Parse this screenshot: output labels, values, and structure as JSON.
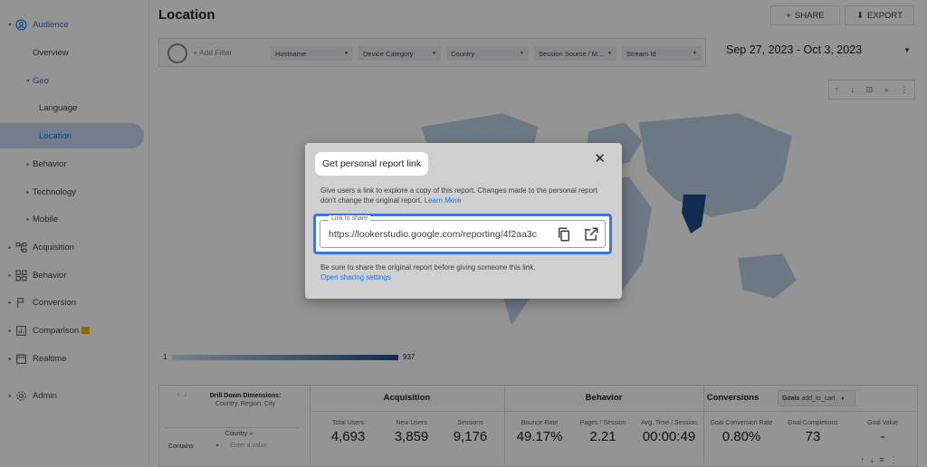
{
  "sidebar": {
    "items": [
      {
        "label": "Audience",
        "icon": "person-circle-icon",
        "caret": "▾"
      },
      {
        "label": "Overview"
      },
      {
        "label": "Geo",
        "caret": "▾"
      },
      {
        "label": "Language"
      },
      {
        "label": "Location"
      },
      {
        "label": "Behavior",
        "caret": "▸"
      },
      {
        "label": "Technology",
        "caret": "▸"
      },
      {
        "label": "Mobile",
        "caret": "▸"
      },
      {
        "label": "Acquisition",
        "icon": "hierarchy-icon",
        "caret": "▸"
      },
      {
        "label": "Behavior",
        "icon": "grid-icon",
        "caret": "▸"
      },
      {
        "label": "Conversion",
        "icon": "flag-icon",
        "caret": "▸"
      },
      {
        "label": "Comparison",
        "icon": "bar-chart-icon",
        "caret": "▸"
      },
      {
        "label": "Realtime",
        "icon": "calendar-icon",
        "caret": "▸"
      },
      {
        "label": "Admin",
        "icon": "gear-icon",
        "caret": "▸"
      }
    ]
  },
  "header": {
    "title": "Location",
    "share_label": "SHARE",
    "export_label": "EXPORT"
  },
  "filters": {
    "add_filter": "+ Add Filter",
    "dropdowns": [
      "Hostname",
      "Device Category",
      "Country",
      "Session Source / M...",
      "Stream Id"
    ]
  },
  "date_range": "Sep 27, 2023 - Oct 3, 2023",
  "map_scale": {
    "min": "1",
    "max": "937"
  },
  "table": {
    "drill_down": "Drill Down Dimensions:",
    "drill_down_fields": "Country, Region, City",
    "country_label": "Country",
    "contains_label": "Contains",
    "value_placeholder": "Enter a value",
    "groups": {
      "acquisition": "Acquisition",
      "behavior": "Behavior",
      "conversions": "Conversions"
    },
    "goals_label": "Goals",
    "goals_value": "add_to_cart",
    "metrics": [
      {
        "label": "Total Users",
        "value": "4,693"
      },
      {
        "label": "New Users",
        "value": "3,859"
      },
      {
        "label": "Sessions",
        "value": "9,176"
      },
      {
        "label": "Bounce Rate",
        "value": "49.17%"
      },
      {
        "label": "Pages / Session",
        "value": "2.21"
      },
      {
        "label": "Avg. Time / Session",
        "value": "00:00:49"
      },
      {
        "label": "Goal Conversion Rate",
        "value": "0.80%"
      },
      {
        "label": "Goal Completions",
        "value": "73"
      },
      {
        "label": "Goal Value",
        "value": "-"
      }
    ]
  },
  "dialog": {
    "title": "Get personal report link",
    "description": "Give users a link to explore a copy of this report. Changes made to the personal report don't change the original report.",
    "learn_more": "Learn More",
    "field_label": "Link to share",
    "link_value": "https://lookerstudio.google.com/reporting/4f2aa3c",
    "note": "Be sure to share the original report before giving someone this link.",
    "sharing_settings": "Open sharing settings"
  }
}
